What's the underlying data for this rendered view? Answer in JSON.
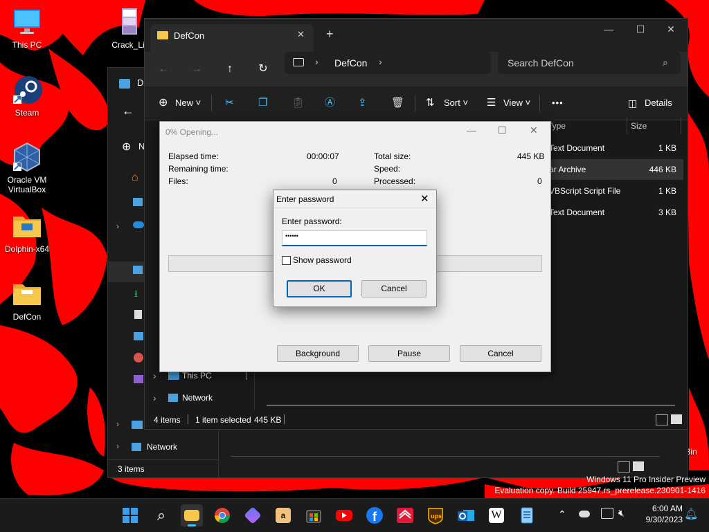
{
  "desktop": {
    "icons": [
      {
        "label": "This PC"
      },
      {
        "label": "Crack_Lic"
      },
      {
        "label": "Steam"
      },
      {
        "label": "Oracle VM VirtualBox"
      },
      {
        "label": "Dolphin-x64"
      },
      {
        "label": "DefCon"
      },
      {
        "label": "Recycle Bin"
      }
    ],
    "watermark_line1": "Windows 11 Pro Insider Preview",
    "watermark_line2": "Evaluation copy. Build 25947.rs_prerelease.230901-1416"
  },
  "back_explorer": {
    "title_fragment": "D",
    "new_fragment": "N",
    "nav_network": "Network",
    "status_items": "3 items"
  },
  "explorer": {
    "tab_title": "DefCon",
    "new_tab": "+",
    "address_segment": "DefCon",
    "search_placeholder": "Search DefCon",
    "cmd": {
      "new": "New",
      "sort": "Sort",
      "view": "View",
      "more": "•••",
      "details": "Details"
    },
    "columns": {
      "type": "Type",
      "size": "Size"
    },
    "rows": [
      {
        "type": "Text Document",
        "size": "1 KB",
        "selected": false
      },
      {
        "type": "ar Archive",
        "size": "446 KB",
        "selected": true
      },
      {
        "type": "VBScript Script File",
        "size": "1 KB",
        "selected": false
      },
      {
        "type": "Text Document",
        "size": "3 KB",
        "selected": false
      }
    ],
    "nav": {
      "this_pc": "This PC",
      "network": "Network"
    },
    "status": {
      "items": "4 items",
      "selected": "1 item selected",
      "selected_size": "445 KB"
    }
  },
  "progress_dialog": {
    "title": "0% Opening...",
    "elapsed_label": "Elapsed time:",
    "elapsed_value": "00:00:07",
    "remaining_label": "Remaining time:",
    "files_label": "Files:",
    "files_value": "0",
    "total_label": "Total size:",
    "total_value": "445 KB",
    "speed_label": "Speed:",
    "processed_label": "Processed:",
    "processed_value": "0",
    "progress_fraction": 0,
    "buttons": {
      "background": "Background",
      "pause": "Pause",
      "cancel": "Cancel"
    }
  },
  "password_dialog": {
    "title": "Enter password",
    "label": "Enter password:",
    "value": "••••••",
    "show_password": "Show password",
    "show_password_checked": false,
    "ok": "OK",
    "cancel": "Cancel"
  },
  "taskbar": {
    "time": "6:00 AM",
    "date": "9/30/2023",
    "apps": [
      "start",
      "search",
      "file-explorer",
      "chrome",
      "copilot",
      "amazon",
      "microsoft-store",
      "youtube",
      "facebook",
      "bank-of-america",
      "ups",
      "outlook",
      "wikipedia",
      "notepad"
    ]
  },
  "colors": {
    "accent": "#0067c0",
    "wallpaper_red": "#ff0000",
    "folder": "#f5c84c"
  }
}
